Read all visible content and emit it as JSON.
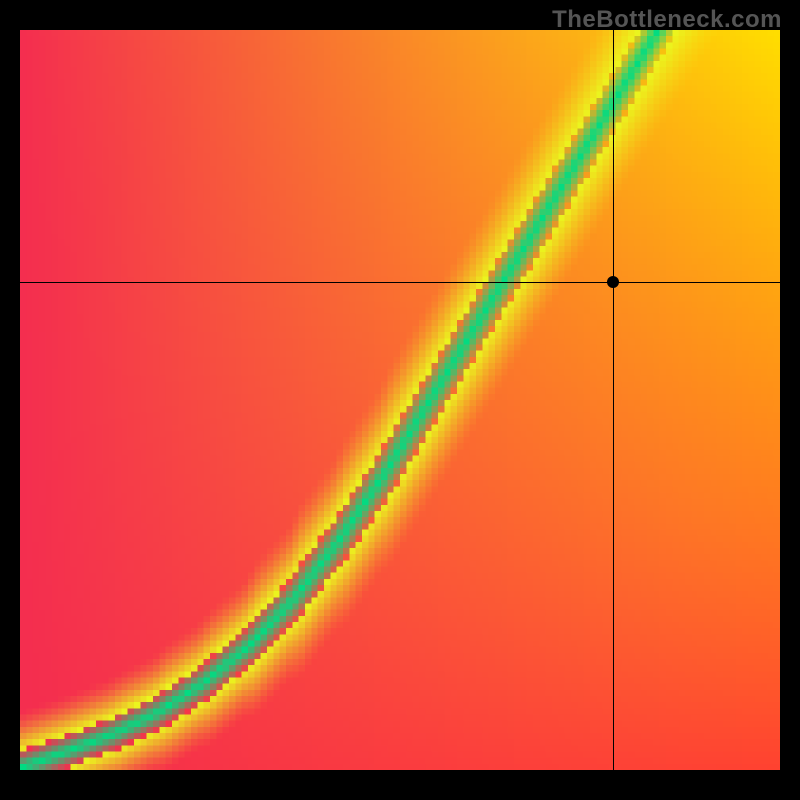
{
  "watermark": "TheBottleneck.com",
  "chart_data": {
    "type": "heatmap",
    "title": "",
    "xlabel": "",
    "ylabel": "",
    "xlim": [
      0,
      1
    ],
    "ylim": [
      0,
      1
    ],
    "crosshair": {
      "x": 0.78,
      "y": 0.66
    },
    "ridge": [
      {
        "x": 0.0,
        "y": 0.0
      },
      {
        "x": 0.06,
        "y": 0.022
      },
      {
        "x": 0.12,
        "y": 0.045
      },
      {
        "x": 0.18,
        "y": 0.075
      },
      {
        "x": 0.24,
        "y": 0.115
      },
      {
        "x": 0.3,
        "y": 0.165
      },
      {
        "x": 0.36,
        "y": 0.23
      },
      {
        "x": 0.42,
        "y": 0.31
      },
      {
        "x": 0.48,
        "y": 0.4
      },
      {
        "x": 0.54,
        "y": 0.5
      },
      {
        "x": 0.6,
        "y": 0.6
      },
      {
        "x": 0.66,
        "y": 0.7
      },
      {
        "x": 0.72,
        "y": 0.8
      },
      {
        "x": 0.78,
        "y": 0.9
      },
      {
        "x": 0.84,
        "y": 1.0
      }
    ],
    "halo_width": 0.038,
    "corners": {
      "top_left": {
        "r": 244,
        "g": 46,
        "b": 79
      },
      "top_right": {
        "r": 255,
        "g": 225,
        "b": 0
      },
      "bottom_left": {
        "r": 244,
        "g": 46,
        "b": 79
      },
      "bottom_right": {
        "r": 255,
        "g": 48,
        "b": 48
      }
    },
    "ridge_color": {
      "r": 0,
      "g": 220,
      "b": 130
    },
    "halo_color": {
      "r": 235,
      "g": 245,
      "b": 30
    },
    "grid": false,
    "legend": null,
    "pixel_resolution": 120
  }
}
